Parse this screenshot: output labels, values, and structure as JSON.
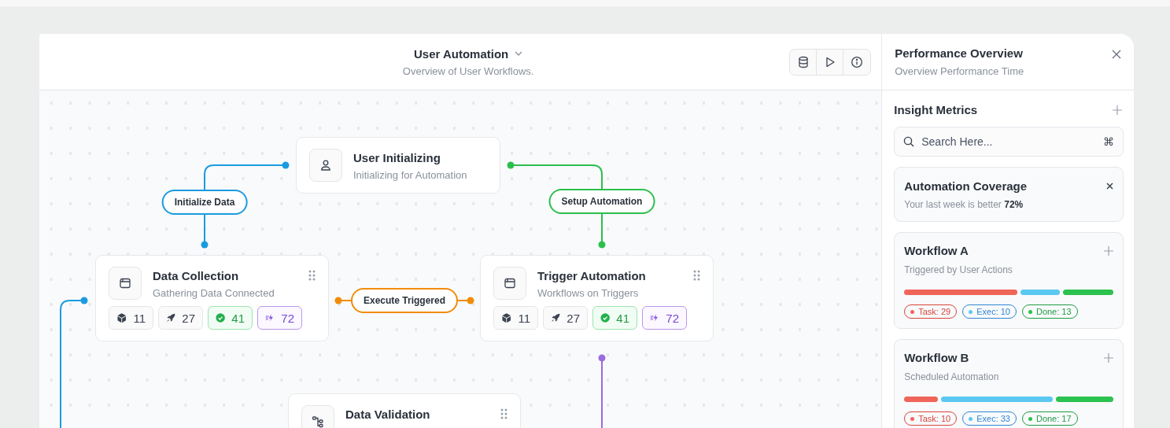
{
  "header": {
    "title": "User Automation",
    "subtitle": "Overview of User Workflows."
  },
  "canvas": {
    "nodes": [
      {
        "kind": "user",
        "title": "User Initializing",
        "subtitle": "Initializing for Automation"
      },
      {
        "kind": "window",
        "title": "Data Collection",
        "subtitle": "Gathering Data Connected",
        "stats": [
          {
            "kind": "cube",
            "value": "11"
          },
          {
            "kind": "rocket",
            "value": "27"
          },
          {
            "kind": "check",
            "value": "41"
          },
          {
            "kind": "bolt",
            "value": "72"
          }
        ]
      },
      {
        "kind": "window",
        "title": "Trigger Automation",
        "subtitle": "Workflows on Triggers",
        "stats": [
          {
            "kind": "cube",
            "value": "11"
          },
          {
            "kind": "rocket",
            "value": "27"
          },
          {
            "kind": "check",
            "value": "41"
          },
          {
            "kind": "bolt",
            "value": "72"
          }
        ]
      },
      {
        "kind": "tree",
        "title": "Data Validation"
      }
    ],
    "edges": [
      {
        "label": "Initialize Data",
        "color": "#1a9be0"
      },
      {
        "label": "Setup Automation",
        "color": "#2cbf4e"
      },
      {
        "label": "Execute Triggered",
        "color": "#f08c0a"
      }
    ]
  },
  "panel": {
    "title": "Performance Overview",
    "subtitle": "Overview Performance Time",
    "section": "Insight Metrics",
    "search": {
      "placeholder": "Search Here...",
      "shortcut": "⌘"
    },
    "coverage": {
      "title": "Automation Coverage",
      "text": "Your last week is better **72%**"
    },
    "workflows": [
      {
        "title": "Workflow A",
        "subtitle": "Triggered by User Actions",
        "segments": [
          {
            "label": "Task:",
            "count": "29",
            "color": "#f0655a"
          },
          {
            "label": "Exec:",
            "count": "10",
            "color": "#5bc8f2"
          },
          {
            "label": "Done:",
            "count": "13",
            "color": "#2bc24f"
          }
        ]
      },
      {
        "title": "Workflow B",
        "subtitle": "Scheduled Automation",
        "segments": [
          {
            "label": "Task:",
            "count": "10",
            "color": "#f0655a"
          },
          {
            "label": "Exec:",
            "count": "33",
            "color": "#5bc8f2"
          },
          {
            "label": "Done:",
            "count": "17",
            "color": "#2bc24f"
          }
        ]
      }
    ]
  }
}
